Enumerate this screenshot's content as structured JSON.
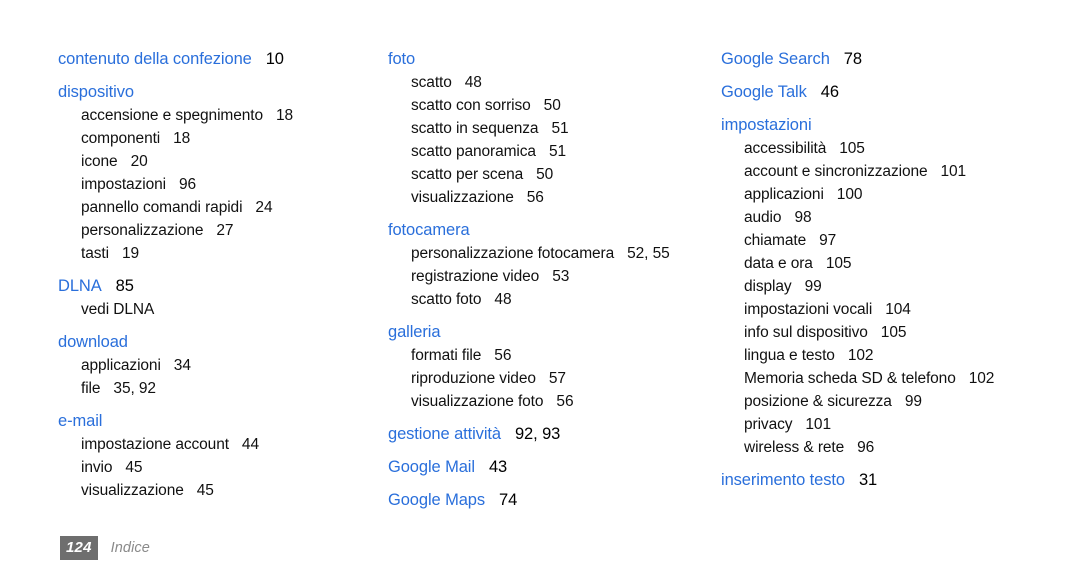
{
  "document": {
    "footer": {
      "page_number": "124",
      "section_label": "Indice"
    },
    "heading_color": "#2a6fdb",
    "text_color": "#111111",
    "background_color": "#ffffff"
  },
  "columns": [
    {
      "groups": [
        {
          "heading": "contenuto della confezione",
          "heading_pages": "10",
          "entries": []
        },
        {
          "heading": "dispositivo",
          "heading_pages": "",
          "entries": [
            {
              "label": "accensione e spegnimento",
              "pages": "18"
            },
            {
              "label": "componenti",
              "pages": "18"
            },
            {
              "label": "icone",
              "pages": "20"
            },
            {
              "label": "impostazioni",
              "pages": "96"
            },
            {
              "label": "pannello comandi rapidi",
              "pages": "24"
            },
            {
              "label": "personalizzazione",
              "pages": "27"
            },
            {
              "label": "tasti",
              "pages": "19"
            }
          ]
        },
        {
          "heading": "DLNA",
          "heading_pages": "85",
          "entries": [
            {
              "label": "vedi DLNA",
              "pages": ""
            }
          ]
        },
        {
          "heading": "download",
          "heading_pages": "",
          "entries": [
            {
              "label": "applicazioni",
              "pages": "34"
            },
            {
              "label": "file",
              "pages": "35, 92"
            }
          ]
        },
        {
          "heading": "e-mail",
          "heading_pages": "",
          "entries": [
            {
              "label": "impostazione account",
              "pages": "44"
            },
            {
              "label": "invio",
              "pages": "45"
            },
            {
              "label": "visualizzazione",
              "pages": "45"
            }
          ]
        }
      ]
    },
    {
      "groups": [
        {
          "heading": "foto",
          "heading_pages": "",
          "entries": [
            {
              "label": "scatto",
              "pages": "48"
            },
            {
              "label": "scatto con sorriso",
              "pages": "50"
            },
            {
              "label": "scatto in sequenza",
              "pages": "51"
            },
            {
              "label": "scatto panoramica",
              "pages": "51"
            },
            {
              "label": "scatto per scena",
              "pages": "50"
            },
            {
              "label": "visualizzazione",
              "pages": "56"
            }
          ]
        },
        {
          "heading": "fotocamera",
          "heading_pages": "",
          "entries": [
            {
              "label": "personalizzazione fotocamera",
              "pages": "52, 55"
            },
            {
              "label": "registrazione video",
              "pages": "53"
            },
            {
              "label": "scatto foto",
              "pages": "48"
            }
          ]
        },
        {
          "heading": "galleria",
          "heading_pages": "",
          "entries": [
            {
              "label": "formati file",
              "pages": "56"
            },
            {
              "label": "riproduzione video",
              "pages": "57"
            },
            {
              "label": "visualizzazione foto",
              "pages": "56"
            }
          ]
        },
        {
          "heading": "gestione attività",
          "heading_pages": "92, 93",
          "entries": []
        },
        {
          "heading": "Google Mail",
          "heading_pages": "43",
          "entries": []
        },
        {
          "heading": "Google Maps",
          "heading_pages": "74",
          "entries": []
        }
      ]
    },
    {
      "groups": [
        {
          "heading": "Google Search",
          "heading_pages": "78",
          "entries": []
        },
        {
          "heading": "Google Talk",
          "heading_pages": "46",
          "entries": []
        },
        {
          "heading": "impostazioni",
          "heading_pages": "",
          "entries": [
            {
              "label": "accessibilità",
              "pages": "105"
            },
            {
              "label": "account e sincronizzazione",
              "pages": "101"
            },
            {
              "label": "applicazioni",
              "pages": "100"
            },
            {
              "label": "audio",
              "pages": "98"
            },
            {
              "label": "chiamate",
              "pages": "97"
            },
            {
              "label": "data e ora",
              "pages": "105"
            },
            {
              "label": "display",
              "pages": "99"
            },
            {
              "label": "impostazioni vocali",
              "pages": "104"
            },
            {
              "label": "info sul dispositivo",
              "pages": "105"
            },
            {
              "label": "lingua e testo",
              "pages": "102"
            },
            {
              "label": "Memoria scheda SD & telefono",
              "pages": "102"
            },
            {
              "label": "posizione & sicurezza",
              "pages": "99"
            },
            {
              "label": "privacy",
              "pages": "101"
            },
            {
              "label": "wireless & rete",
              "pages": "96"
            }
          ]
        },
        {
          "heading": "inserimento testo",
          "heading_pages": "31",
          "entries": []
        }
      ]
    }
  ]
}
